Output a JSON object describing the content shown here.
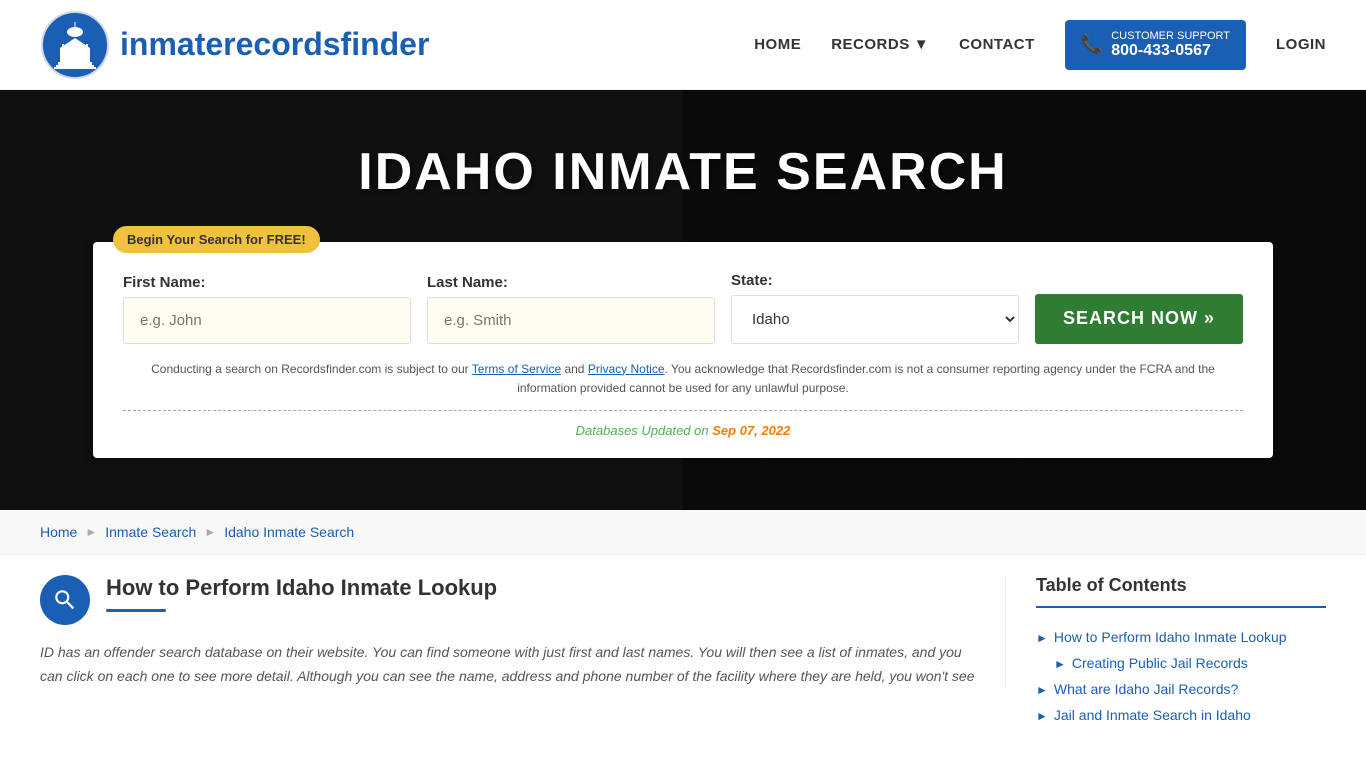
{
  "header": {
    "logo_text_regular": "inmaterecords",
    "logo_text_bold": "finder",
    "nav": {
      "home_label": "HOME",
      "records_label": "RECORDS",
      "contact_label": "CONTACT",
      "support_label": "CUSTOMER SUPPORT",
      "support_number": "800-433-0567",
      "login_label": "LOGIN"
    }
  },
  "hero": {
    "title": "IDAHO INMATE SEARCH",
    "free_badge": "Begin Your Search for FREE!",
    "form": {
      "first_name_label": "First Name:",
      "first_name_placeholder": "e.g. John",
      "last_name_label": "Last Name:",
      "last_name_placeholder": "e.g. Smith",
      "state_label": "State:",
      "state_value": "Idaho",
      "search_button": "SEARCH NOW »"
    },
    "disclaimer": {
      "text1": "Conducting a search on Recordsfinder.com is subject to our ",
      "tos": "Terms of Service",
      "text2": " and ",
      "privacy": "Privacy Notice",
      "text3": ". You acknowledge that Recordsfinder.com is not a consumer reporting agency under the FCRA and the information provided cannot be used for any unlawful purpose."
    },
    "db_label": "Databases Updated on",
    "db_date": "Sep 07, 2022"
  },
  "breadcrumb": {
    "home": "Home",
    "inmate_search": "Inmate Search",
    "current": "Idaho Inmate Search"
  },
  "article": {
    "title": "How to Perform Idaho Inmate Lookup",
    "body": "ID has an offender search database on their website. You can find someone with just first and last names. You will then see a list of inmates, and you can click on each one to see more detail. Although you can see the name, address and phone number of the facility where they are held, you won't see"
  },
  "toc": {
    "title": "Table of Contents",
    "items": [
      {
        "label": "How to Perform Idaho Inmate Lookup",
        "sub": false
      },
      {
        "label": "Creating Public Jail Records",
        "sub": true
      },
      {
        "label": "What are Idaho Jail Records?",
        "sub": false
      },
      {
        "label": "Jail and Inmate Search in Idaho",
        "sub": false
      }
    ]
  }
}
